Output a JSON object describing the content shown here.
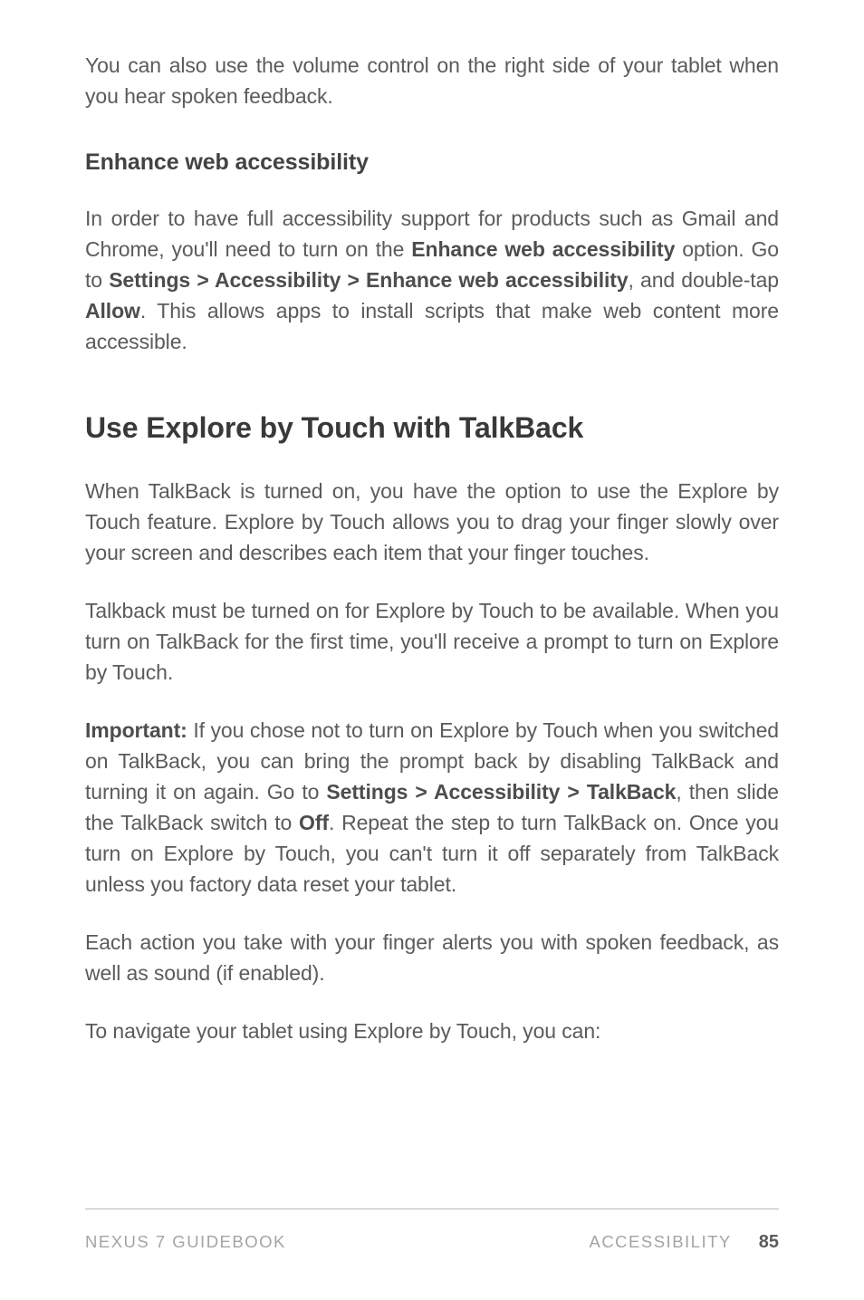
{
  "intro": "You can also use the volume control on the right side of your tab­let when you hear spoken feedback.",
  "h3_enhance": "Enhance web accessibility",
  "enhance_para": {
    "seg1": "In order to have full accessibility support for products such as Gmail and Chrome,  you'll need to turn on the ",
    "b1": "Enhance web ac­cessibility",
    "seg2": " option. Go to ",
    "b2": "Settings > Accessibility > Enhance web accessibility",
    "seg3": ", and double-tap ",
    "b3": "Allow",
    "seg4": ". This allows apps to install scripts that make web content more accessible."
  },
  "h2_use": "Use Explore by Touch with TalkBack",
  "p_touch1": "When TalkBack is turned on, you have the option to use the Ex­plore by Touch feature. Explore by Touch allows you to drag your finger slowly over your screen and describes each item that your finger touches.",
  "p_touch2": "Talkback must be turned on for Explore by Touch to be avail­able. When you turn on TalkBack for the first time, you'll receive a prompt to turn on Explore by Touch.",
  "p_important": {
    "b_important": "Important:",
    "seg1": " If you chose not to turn on Explore by Touch when you switched on TalkBack, you can bring the prompt back by dis­abling TalkBack and turning it on again. Go to ",
    "b_settings": "Settings > Acces­sibility > TalkBack",
    "seg2": ", then slide the TalkBack switch to ",
    "b_off": "Off",
    "seg3": ". Repeat the step to turn TalkBack on. Once you turn on Explore by Touch, you can't turn it off separately from TalkBack unless you factory data reset your tablet."
  },
  "p_action": "Each action you take with your finger alerts you with spoken feed­back, as well as sound (if enabled).",
  "p_navigate": "To navigate your tablet using Explore by Touch, you can:",
  "footer": {
    "left": "NEXUS 7 GUIDEBOOK",
    "right_label": "ACCESSIBILITY",
    "page": "85"
  }
}
